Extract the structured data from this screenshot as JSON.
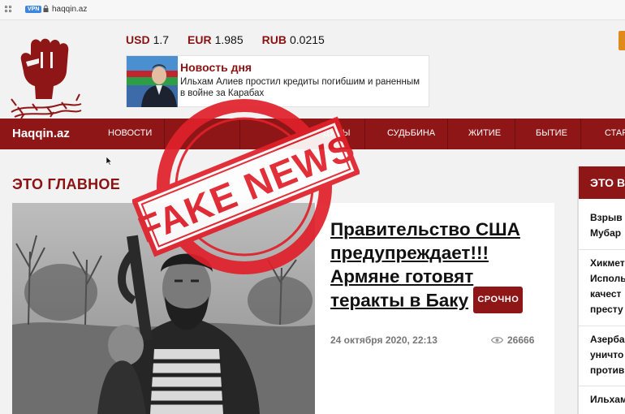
{
  "browser": {
    "url": "haqqin.az",
    "vpn_label": "VPN"
  },
  "rates": [
    {
      "code": "USD",
      "value": "1.7"
    },
    {
      "code": "EUR",
      "value": "1.985"
    },
    {
      "code": "RUB",
      "value": "0.0215"
    }
  ],
  "news_of_day": {
    "title": "Новость дня",
    "text": "Ильхам Алиев простил кредиты погибшим и раненным в войне за Карабах"
  },
  "nav": {
    "brand": "Haqqin.az",
    "items": [
      "НОВОСТИ",
      "ДУМЫ",
      "СУДЬБИНА",
      "ЖИТИЕ",
      "БЫТИЕ",
      "СТАРШ"
    ]
  },
  "main": {
    "section_title": "ЭТО ГЛАВНОЕ",
    "headline": "Правительство США предупреждает!!! Армяне готовят теракты в Баку",
    "badge": "СРОЧНО",
    "date": "24 октября 2020, 22:13",
    "views": "26666"
  },
  "sidebar": {
    "title": "ЭТО В",
    "items": [
      [
        "Взрыв в",
        "Мубар"
      ],
      [
        "Хикмет",
        "Исполь",
        "качест",
        "престу"
      ],
      [
        "Азербай",
        "уничто",
        "против"
      ],
      [
        "Ильхам",
        ""
      ]
    ]
  },
  "stamp": {
    "text": "FAKE NEWS"
  },
  "colors": {
    "brand": "#8f1616",
    "stamp": "#e0202a",
    "accent": "#e08a1e"
  }
}
